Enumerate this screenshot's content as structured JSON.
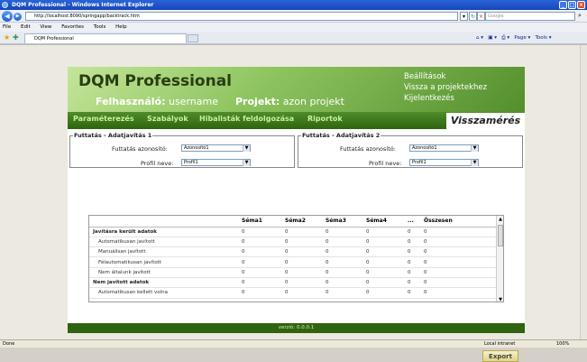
{
  "window": {
    "title": "DQM Professional - Windows Internet Explorer",
    "url": "http://localhost:8090/springapp/backtrack.htm",
    "search_placeholder": "Google",
    "tab_title": "DQM Professional"
  },
  "menu": [
    "File",
    "Edit",
    "View",
    "Favorites",
    "Tools",
    "Help"
  ],
  "toolbar": {
    "page": "Page",
    "tools": "Tools"
  },
  "header": {
    "brand": "DQM Professional",
    "user_label": "Felhasználó:",
    "user_value": "username",
    "project_label": "Projekt:",
    "project_value": "azon projekt",
    "links": [
      "Beállítások",
      "Vissza a projektekhez",
      "Kijelentkezés"
    ]
  },
  "nav": {
    "items": [
      "Paraméterezés",
      "Szabályok",
      "Hibalisták feldolgozása",
      "Riportok"
    ],
    "active": "Visszamérés"
  },
  "fieldset1": {
    "legend": "Futtatás - Adatjavítás 1",
    "run_label": "Futtatás azonosító:",
    "run_value": "Azonosító1",
    "profile_label": "Profil neve:",
    "profile_value": "Profil1"
  },
  "fieldset2": {
    "legend": "Futtatás - Adatjavítás 2",
    "run_label": "Futtatás azonosító:",
    "run_value": "Azonosító1",
    "profile_label": "Profil neve:",
    "profile_value": "Profil1"
  },
  "table": {
    "columns": [
      "",
      "Séma1",
      "Séma2",
      "Séma3",
      "Séma4",
      "...",
      "Összesen"
    ],
    "rows": [
      {
        "label": "Javításra került adatok",
        "group": true,
        "values": [
          "0",
          "0",
          "0",
          "0",
          "0",
          "0"
        ]
      },
      {
        "label": "Automatikusan javított",
        "group": false,
        "values": [
          "0",
          "0",
          "0",
          "0",
          "0",
          "0"
        ]
      },
      {
        "label": "Manuálisan javított",
        "group": false,
        "values": [
          "0",
          "0",
          "0",
          "0",
          "0",
          "0"
        ]
      },
      {
        "label": "Félautomatikusan javított",
        "group": false,
        "values": [
          "0",
          "0",
          "0",
          "0",
          "0",
          "0"
        ]
      },
      {
        "label": "Nem általunk javított",
        "group": false,
        "values": [
          "0",
          "0",
          "0",
          "0",
          "0",
          "0"
        ]
      },
      {
        "label": "Nem javított adatok",
        "group": true,
        "values": [
          "0",
          "0",
          "0",
          "0",
          "0",
          "0"
        ]
      },
      {
        "label": "Automatikusan kellett volna",
        "group": false,
        "values": [
          "0",
          "0",
          "0",
          "0",
          "0",
          "0"
        ]
      }
    ]
  },
  "export_label": "Export",
  "footer": "verzió: 0.0.0.1",
  "status": {
    "left": "Done",
    "zone": "Local intranet",
    "zoom": "100%"
  },
  "colors": {
    "header_dark": "#2f6410",
    "header_light": "#c4e59a",
    "nav_text": "#c8f39a"
  }
}
